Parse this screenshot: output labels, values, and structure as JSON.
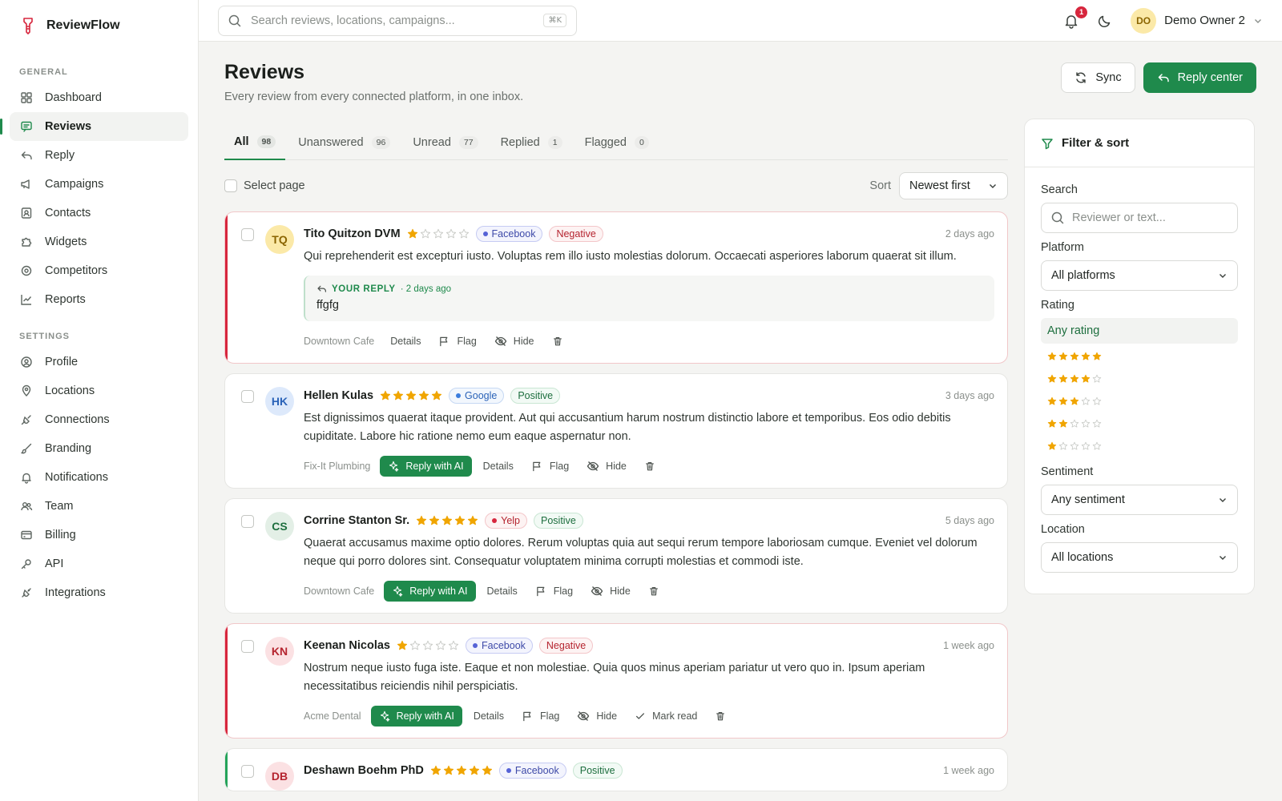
{
  "brand": {
    "name": "ReviewFlow"
  },
  "sidebar": {
    "general_label": "GENERAL",
    "settings_label": "SETTINGS",
    "general": [
      {
        "label": "Dashboard",
        "icon": "grid-icon"
      },
      {
        "label": "Reviews",
        "icon": "message-icon",
        "active": true
      },
      {
        "label": "Reply",
        "icon": "reply-icon"
      },
      {
        "label": "Campaigns",
        "icon": "megaphone-icon"
      },
      {
        "label": "Contacts",
        "icon": "contact-icon"
      },
      {
        "label": "Widgets",
        "icon": "puzzle-icon"
      },
      {
        "label": "Competitors",
        "icon": "target-icon"
      },
      {
        "label": "Reports",
        "icon": "chart-icon"
      }
    ],
    "settings": [
      {
        "label": "Profile",
        "icon": "user-circle-icon"
      },
      {
        "label": "Locations",
        "icon": "pin-icon"
      },
      {
        "label": "Connections",
        "icon": "plug-icon"
      },
      {
        "label": "Branding",
        "icon": "brush-icon"
      },
      {
        "label": "Notifications",
        "icon": "bell-icon"
      },
      {
        "label": "Team",
        "icon": "users-icon"
      },
      {
        "label": "Billing",
        "icon": "card-icon"
      },
      {
        "label": "API",
        "icon": "key-icon"
      },
      {
        "label": "Integrations",
        "icon": "integrations-icon"
      }
    ]
  },
  "topbar": {
    "search_placeholder": "Search reviews, locations, campaigns...",
    "shortcut": "⌘K",
    "notification_count": "1",
    "user_initials": "DO",
    "user_name": "Demo Owner 2"
  },
  "page": {
    "title": "Reviews",
    "subtitle": "Every review from every connected platform, in one inbox.",
    "sync_label": "Sync",
    "reply_center_label": "Reply center"
  },
  "tabs": [
    {
      "label": "All",
      "count": "98",
      "active": true
    },
    {
      "label": "Unanswered",
      "count": "96"
    },
    {
      "label": "Unread",
      "count": "77"
    },
    {
      "label": "Replied",
      "count": "1"
    },
    {
      "label": "Flagged",
      "count": "0"
    }
  ],
  "toolbar": {
    "select_page": "Select page",
    "sort_label": "Sort",
    "sort_value": "Newest first"
  },
  "colors": {
    "accent": "#1f8a4c",
    "negative": "#d7263d",
    "star": "#f0a500"
  },
  "reviews": [
    {
      "initials": "TQ",
      "name": "Tito Quitzon DVM",
      "rating": 1,
      "platform": "Facebook",
      "platform_class": "fb",
      "sentiment": "Negative",
      "sentiment_class": "negp",
      "ago": "2 days ago",
      "text": "Qui reprehenderit est excepturi iusto. Voluptas rem illo iusto molestias dolorum. Occaecati asperiores laborum quaerat sit illum.",
      "reply": {
        "label": "YOUR REPLY",
        "ago": "· 2 days ago",
        "text": "ffgfg"
      },
      "location": "Downtown Cafe",
      "actions": [
        "Details",
        "Flag",
        "Hide"
      ],
      "ai": false,
      "mark_read": false,
      "avatar_bg": "#fbe9a8",
      "avatar_fg": "#8a6400",
      "kind": "neg"
    },
    {
      "initials": "HK",
      "name": "Hellen Kulas",
      "rating": 5,
      "platform": "Google",
      "platform_class": "gg",
      "sentiment": "Positive",
      "sentiment_class": "posp",
      "ago": "3 days ago",
      "text": "Est dignissimos quaerat itaque provident. Aut qui accusantium harum nostrum distinctio labore et temporibus. Eos odio debitis cupiditate. Labore hic ratione nemo eum eaque aspernatur non.",
      "location": "Fix-It Plumbing",
      "ai": true,
      "ai_label": "Reply with AI",
      "actions": [
        "Details",
        "Flag",
        "Hide"
      ],
      "mark_read": false,
      "avatar_bg": "#dde9fb",
      "avatar_fg": "#2b63b8",
      "kind": "none"
    },
    {
      "initials": "CS",
      "name": "Corrine Stanton Sr.",
      "rating": 5,
      "platform": "Yelp",
      "platform_class": "yp",
      "sentiment": "Positive",
      "sentiment_class": "posp",
      "ago": "5 days ago",
      "text": "Quaerat accusamus maxime optio dolores. Rerum voluptas quia aut sequi rerum tempore laboriosam cumque. Eveniet vel dolorum neque qui porro dolores sint. Consequatur voluptatem minima corrupti molestias et commodi iste.",
      "location": "Downtown Cafe",
      "ai": true,
      "ai_label": "Reply with AI",
      "actions": [
        "Details",
        "Flag",
        "Hide"
      ],
      "mark_read": false,
      "avatar_bg": "#e3efe6",
      "avatar_fg": "#1d6e3e",
      "kind": "none"
    },
    {
      "initials": "KN",
      "name": "Keenan Nicolas",
      "rating": 1,
      "platform": "Facebook",
      "platform_class": "fb",
      "sentiment": "Negative",
      "sentiment_class": "negp",
      "ago": "1 week ago",
      "text": "Nostrum neque iusto fuga iste. Eaque et non molestiae. Quia quos minus aperiam pariatur ut vero quo in. Ipsum aperiam necessitatibus reiciendis nihil perspiciatis.",
      "location": "Acme Dental",
      "ai": true,
      "ai_label": "Reply with AI",
      "actions": [
        "Details",
        "Flag",
        "Hide"
      ],
      "mark_read": true,
      "mark_read_label": "Mark read",
      "avatar_bg": "#fbe1e3",
      "avatar_fg": "#b5242f",
      "kind": "neg"
    },
    {
      "initials": "DB",
      "name": "Deshawn Boehm PhD",
      "rating": 5,
      "platform": "Facebook",
      "platform_class": "fb",
      "sentiment": "Positive",
      "sentiment_class": "posp",
      "ago": "1 week ago",
      "text": "",
      "location": "",
      "ai": false,
      "actions": [],
      "mark_read": false,
      "avatar_bg": "#fbe1e3",
      "avatar_fg": "#b5242f",
      "kind": "pos"
    }
  ],
  "filter": {
    "title": "Filter & sort",
    "search_label": "Search",
    "search_placeholder": "Reviewer or text...",
    "platform_label": "Platform",
    "platform_value": "All platforms",
    "rating_label": "Rating",
    "rating_any": "Any rating",
    "rating_options": [
      5,
      4,
      3,
      2,
      1
    ],
    "sentiment_label": "Sentiment",
    "sentiment_value": "Any sentiment",
    "location_label": "Location",
    "location_value": "All locations"
  }
}
